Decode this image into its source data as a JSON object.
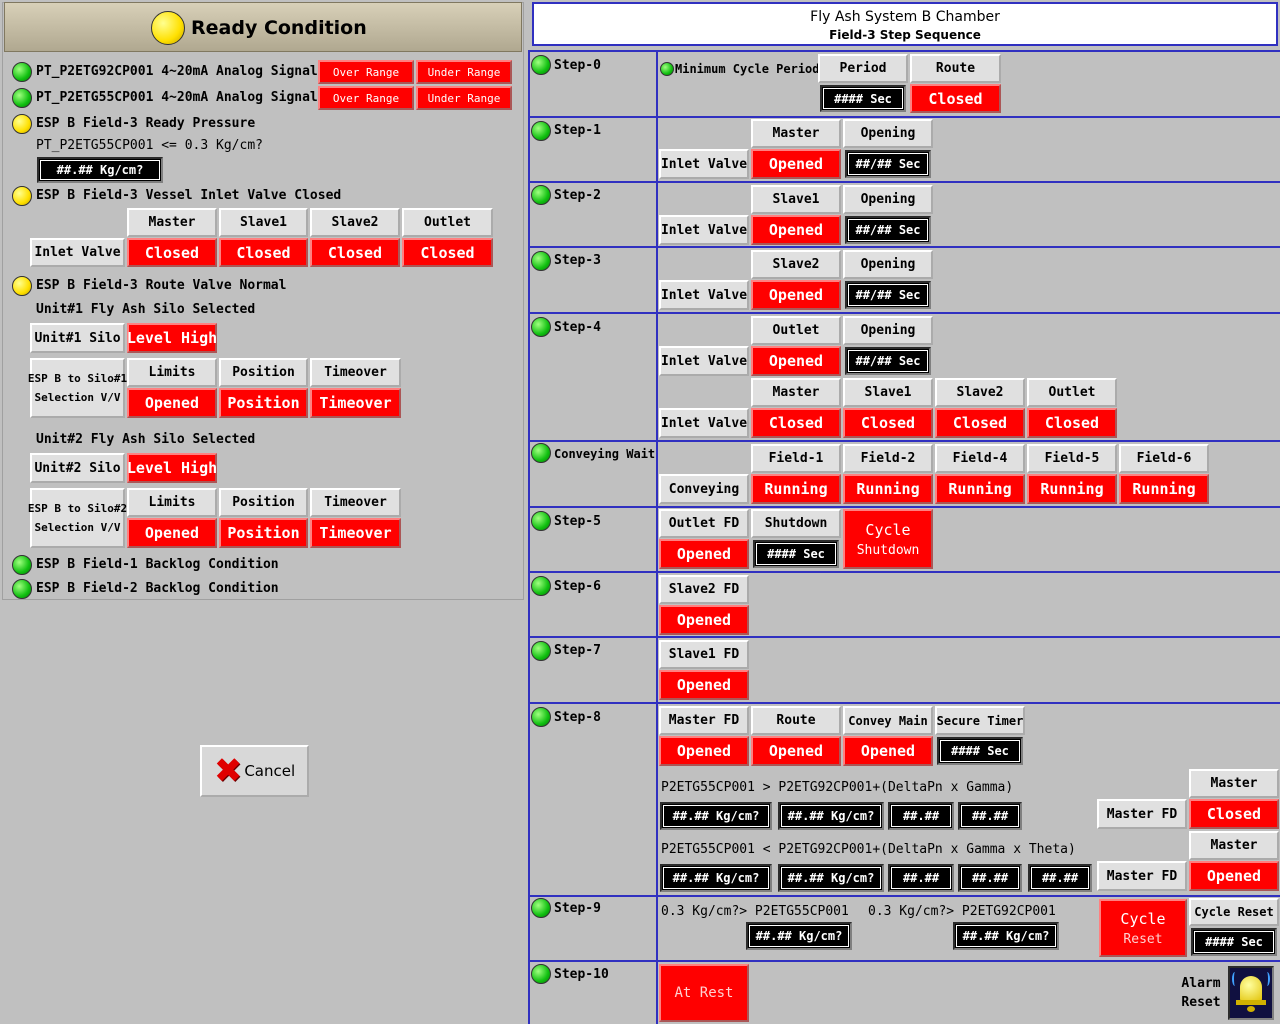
{
  "left": {
    "header_title": "Ready Condition",
    "pt1": "PT_P2ETG92CP001 4~20mA Analog Signal",
    "pt2": "PT_P2ETG55CP001 4~20mA Analog Signal",
    "over_range": "Over Range",
    "under_range": "Under Range",
    "ready_pressure": "ESP B Field-3 Ready Pressure",
    "pressure_cond": "PT_P2ETG55CP001 <= 0.3 Kg/cm?",
    "pressure_value": "##.## Kg/cm?",
    "vessel_inlet": "ESP B Field-3 Vessel Inlet Valve Closed",
    "col_master": "Master",
    "col_slave1": "Slave1",
    "col_slave2": "Slave2",
    "col_outlet": "Outlet",
    "inlet_valve": "Inlet Valve",
    "closed": "Closed",
    "route_normal": "ESP B Field-3 Route Valve Normal",
    "unit1_selected": "Unit#1 Fly Ash Silo Selected",
    "unit1_silo": "Unit#1 Silo",
    "level_high": "Level High",
    "sel1_line1": "ESP B to Silo#1",
    "sel1_line2": "Selection V/V",
    "limits": "Limits",
    "position": "Position",
    "timeover": "Timeover",
    "opened": "Opened",
    "unit2_selected": "Unit#2 Fly Ash Silo Selected",
    "unit2_silo": "Unit#2 Silo",
    "sel2_line1": "ESP B to Silo#2",
    "sel2_line2": "Selection V/V",
    "backlog1": "ESP B Field-1 Backlog Condition",
    "backlog2": "ESP B Field-2 Backlog Condition",
    "cancel": "Cancel"
  },
  "right": {
    "title": "Fly Ash System B Chamber",
    "subtitle": "Field-3 Step Sequence",
    "step0": "Step-0",
    "step1": "Step-1",
    "step2": "Step-2",
    "step3": "Step-3",
    "step4": "Step-4",
    "conveying_wait": "Conveying Wait",
    "step5": "Step-5",
    "step6": "Step-6",
    "step7": "Step-7",
    "step8": "Step-8",
    "step9": "Step-9",
    "step10": "Step-10",
    "min_cycle": "Minimum Cycle Period",
    "period": "Period",
    "route": "Route",
    "sec_value": "#### Sec",
    "closed": "Closed",
    "opened": "Opened",
    "master": "Master",
    "slave1": "Slave1",
    "slave2": "Slave2",
    "outlet": "Outlet",
    "opening": "Opening",
    "inlet_valve": "Inlet Valve",
    "opening_value": "##/## Sec",
    "field1": "Field-1",
    "field2": "Field-2",
    "field4": "Field-4",
    "field5": "Field-5",
    "field6": "Field-6",
    "conveying": "Conveying",
    "running": "Running",
    "outlet_fd": "Outlet FD",
    "shutdown": "Shutdown",
    "cycle_shutdown_1": "Cycle",
    "cycle_shutdown_2": "Shutdown",
    "slave2_fd": "Slave2 FD",
    "slave1_fd": "Slave1 FD",
    "master_fd": "Master FD",
    "convey_main": "Convey Main",
    "secure_timer": "Secure Timer",
    "formula1": "P2ETG55CP001 > P2ETG92CP001+(DeltaPn x Gamma)",
    "formula2": "P2ETG55CP001 < P2ETG92CP001+(DeltaPn  x  Gamma  x  Theta)",
    "kg_value": "##.## Kg/cm?",
    "num_value": "##.##",
    "cond_a": "0.3 Kg/cm?> P2ETG55CP001",
    "cond_b": "0.3 Kg/cm?> P2ETG92CP001",
    "cycle_reset_1": "Cycle",
    "cycle_reset_2": "Reset",
    "cycle_reset_label": "Cycle Reset",
    "at_rest": "At Rest",
    "alarm_1": "Alarm",
    "alarm_2": "Reset"
  }
}
